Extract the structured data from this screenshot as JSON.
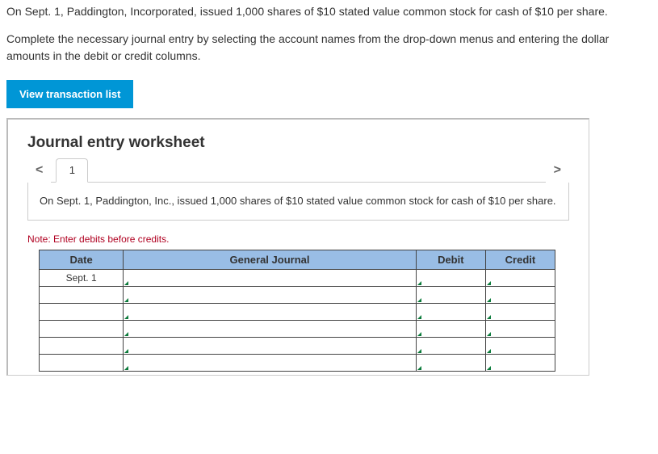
{
  "problem": {
    "p1": "On Sept. 1, Paddington, Incorporated, issued 1,000 shares of $10 stated value common stock for cash of $10 per share.",
    "p2": "Complete the necessary journal entry by selecting the account names from the drop-down menus and entering the dollar amounts in the debit or credit columns."
  },
  "buttons": {
    "view_list": "View transaction list"
  },
  "worksheet": {
    "title": "Journal entry worksheet",
    "nav": {
      "prev": "<",
      "next": ">",
      "tab1": "1"
    },
    "description": "On Sept. 1, Paddington, Inc., issued 1,000 shares of $10 stated value common stock for cash of $10 per share.",
    "note": "Note: Enter debits before credits.",
    "headers": {
      "date": "Date",
      "gj": "General Journal",
      "debit": "Debit",
      "credit": "Credit"
    },
    "rows": [
      {
        "date": "Sept. 1",
        "gj": "",
        "debit": "",
        "credit": ""
      },
      {
        "date": "",
        "gj": "",
        "debit": "",
        "credit": ""
      },
      {
        "date": "",
        "gj": "",
        "debit": "",
        "credit": ""
      },
      {
        "date": "",
        "gj": "",
        "debit": "",
        "credit": ""
      },
      {
        "date": "",
        "gj": "",
        "debit": "",
        "credit": ""
      },
      {
        "date": "",
        "gj": "",
        "debit": "",
        "credit": ""
      }
    ]
  }
}
